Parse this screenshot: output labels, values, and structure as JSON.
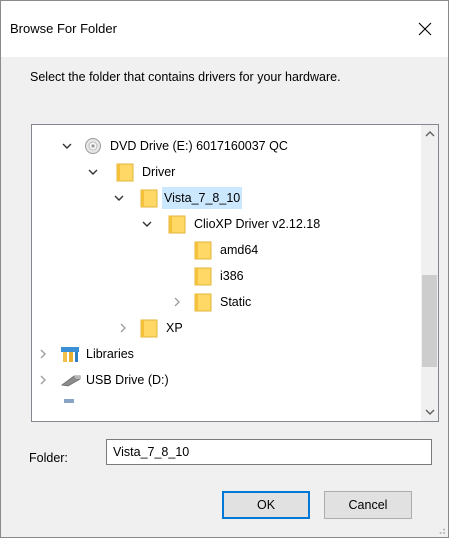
{
  "window": {
    "title": "Browse For Folder"
  },
  "instruction": "Select the folder that contains drivers for your hardware.",
  "tree": {
    "items": [
      {
        "label": "DVD Drive (E:) 6017160037 QC",
        "icon": "dvd-drive-icon",
        "expander": "expanded"
      },
      {
        "label": "Driver",
        "icon": "folder-icon",
        "expander": "expanded"
      },
      {
        "label": "Vista_7_8_10",
        "icon": "folder-icon",
        "expander": "expanded",
        "selected": true
      },
      {
        "label": "ClioXP Driver v2.12.18",
        "icon": "folder-icon",
        "expander": "expanded"
      },
      {
        "label": "amd64",
        "icon": "folder-icon",
        "expander": "none"
      },
      {
        "label": "i386",
        "icon": "folder-icon",
        "expander": "none"
      },
      {
        "label": "Static",
        "icon": "folder-icon",
        "expander": "collapsed"
      },
      {
        "label": "XP",
        "icon": "folder-icon",
        "expander": "collapsed"
      },
      {
        "label": "Libraries",
        "icon": "libraries-icon",
        "expander": "collapsed"
      },
      {
        "label": "USB Drive (D:)",
        "icon": "usb-drive-icon",
        "expander": "collapsed"
      }
    ]
  },
  "folder": {
    "label": "Folder:",
    "value": "Vista_7_8_10"
  },
  "buttons": {
    "ok": "OK",
    "cancel": "Cancel"
  },
  "colors": {
    "selection": "#cce8ff",
    "accent": "#0078d7",
    "folder": "#ffd866"
  }
}
